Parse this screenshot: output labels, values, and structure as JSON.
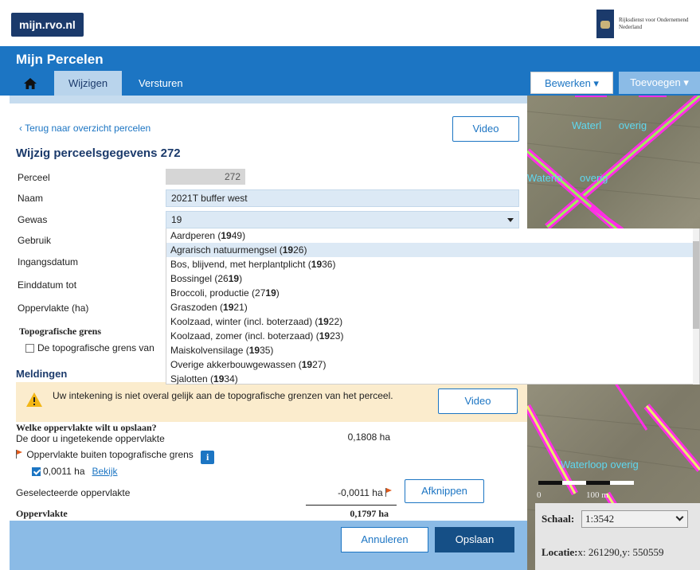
{
  "brand": {
    "portal": "mijn.rvo.nl",
    "gov_line1": "Rijksdienst voor Ondernemend",
    "gov_line2": "Nederland"
  },
  "app": {
    "title": "Mijn Percelen",
    "tabs": [
      {
        "label": "Wijzigen"
      },
      {
        "label": "Versturen"
      }
    ],
    "bewerken": "Bewerken ▾",
    "toevoegen": "Toevoegen ▾"
  },
  "form": {
    "back": "‹  Terug naar overzicht percelen",
    "video": "Video",
    "title": "Wijzig perceelsgegevens 272",
    "perceel_label": "Perceel",
    "perceel_value": "272",
    "naam_label": "Naam",
    "naam_value": "2021T buffer west",
    "gewas_label": "Gewas",
    "gewas_value": "19",
    "gebruik_label": "Gebruik",
    "ingangsdatum_label": "Ingangsdatum",
    "einddatum_label": "Einddatum tot",
    "oppervlakte_label": "Oppervlakte (ha)",
    "topo_title": "Topografische grens",
    "topo_check": "De topografische grens van"
  },
  "dropdown": {
    "highlight": "19",
    "selected_index": 1,
    "items": [
      {
        "pre": "Aardperen (",
        "bold": "19",
        "post": "49)"
      },
      {
        "pre": "Agrarisch natuurmengsel (",
        "bold": "19",
        "post": "26)"
      },
      {
        "pre": "Bos, blijvend, met herplantplicht (",
        "bold": "19",
        "post": "36)"
      },
      {
        "pre": "Bossingel (26",
        "bold": "19",
        "post": ")"
      },
      {
        "pre": "Broccoli, productie (27",
        "bold": "19",
        "post": ")"
      },
      {
        "pre": "Graszoden (",
        "bold": "19",
        "post": "21)"
      },
      {
        "pre": "Koolzaad, winter (incl. boterzaad) (",
        "bold": "19",
        "post": "22)"
      },
      {
        "pre": "Koolzaad, zomer (incl. boterzaad) (",
        "bold": "19",
        "post": "23)"
      },
      {
        "pre": "Maiskolvensilage (",
        "bold": "19",
        "post": "35)"
      },
      {
        "pre": "Overige akkerbouwgewassen (",
        "bold": "19",
        "post": "27)"
      },
      {
        "pre": "Sjalotten (",
        "bold": "19",
        "post": "34)"
      }
    ]
  },
  "meldingen": {
    "title": "Meldingen",
    "warning": "Uw intekening is niet overal gelijk aan de topografische grenzen van het perceel.",
    "video": "Video"
  },
  "summary": {
    "question": "Welke oppervlakte wilt u opslaan?",
    "drawn_label": "De door u ingetekende oppervlakte",
    "drawn_value": "0,1808 ha",
    "outside_label": "Oppervlakte buiten topografische grens",
    "info": "i",
    "checked_value": "0,0011 ha",
    "bekijk": "Bekijk",
    "selected_label": "Geselecteerde oppervlakte",
    "selected_value": "-0,0011 ha",
    "afknippen": "Afknippen",
    "total_label": "Oppervlakte",
    "total_value": "0,1797 ha"
  },
  "footer": {
    "cancel": "Annuleren",
    "save": "Opslaan"
  },
  "map": {
    "labels": [
      "Waterl",
      "overig",
      "Waterlo",
      "overig",
      "Waterloop overig"
    ],
    "scale_left": "0",
    "scale_right": "100 m",
    "schaal_label": "Schaal:",
    "schaal_value": "1:3542",
    "locatie_label": "Locatie:",
    "locatie_value": "x: 261290,y: 550559"
  },
  "colors": {
    "primary": "#1c75c3",
    "dark": "#1b3a6b",
    "warning_bg": "#fbeccd",
    "parcel_line": "#ff2ee6",
    "water_line": "#9df05a"
  }
}
